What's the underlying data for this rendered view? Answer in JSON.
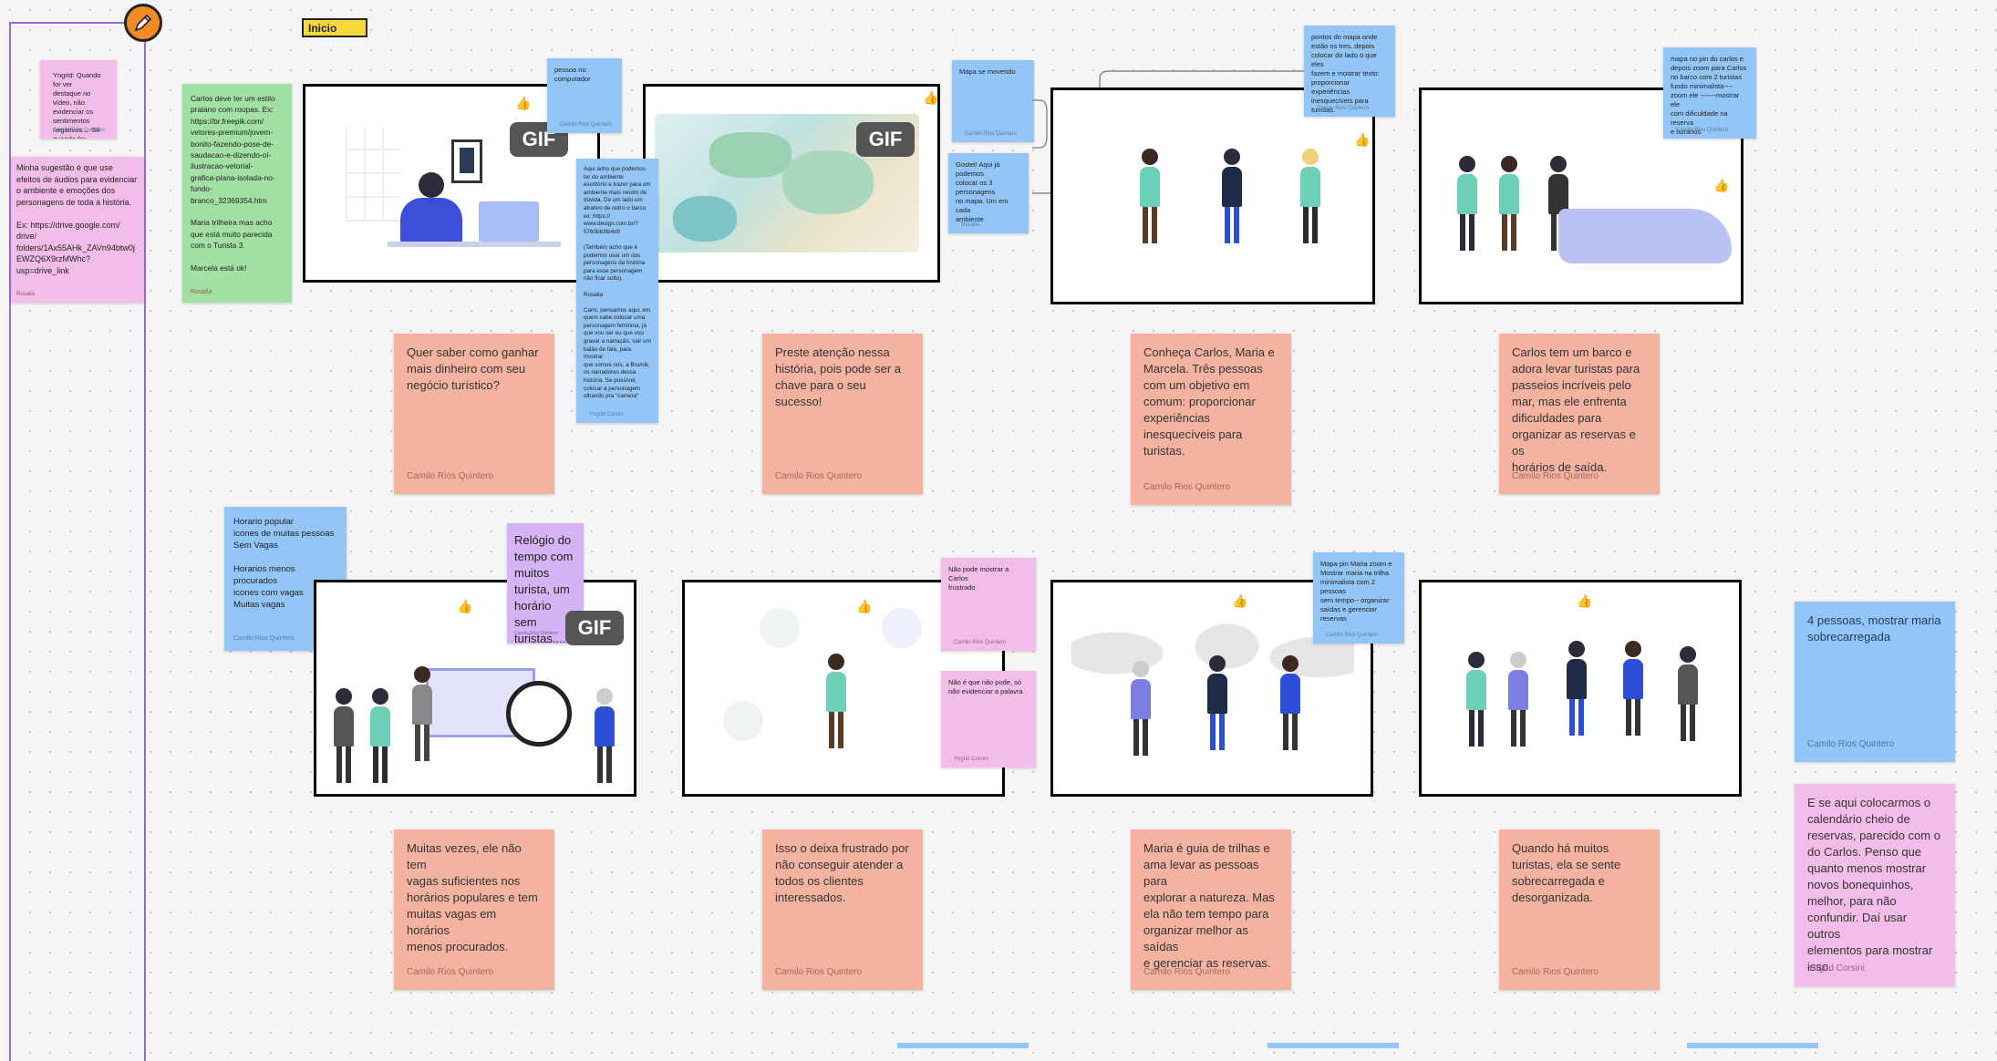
{
  "start_tag": "Inicio",
  "colors": {
    "salmon": "#f4b3a1",
    "blue": "#93c5f7",
    "pink": "#f3bde9",
    "green": "#a3e0a3",
    "lilac": "#d6b4f3",
    "section_border": "#9b6bd8"
  },
  "comments": {
    "c1_text": "Yngrid: Quando for ver\ndestaque no vídeo, não\nevidenciar os sentimentos\nnegativos.... Só quando for\nos positivos",
    "c1_author": "Camilo Rios Quintero",
    "c2_text": "Minha sugestão é que use\nefeitos de áudios para evidenciar\no ambiente e emoções dos\npersonagens de toda a história.\n\nEx: https://drive.google.com/\ndrive/\nfolders/1Ax55AHk_ZAVn94btw0j\nEWZQ6X9rzMWhc?\nusp=drive_link",
    "c2_author": "Rosalia",
    "c3_text": "Carlos deve ter um estilo\npraiano com roupas. Ex:\nhttps://br.freepik.com/\nvetores-premium/jovem-\nbonito-fazendo-pose-de-\nsaudacao-e-dizendo-oi-\nilustracao-vetorial-\ngrafica-plana-isolada-no-\nfundo-\nbranco_32369354.htm\n\nMaria trilheira mas acho\nque está muito parecida\ncom o Turista 3.\n\nMarcela está ok!",
    "c3_author": "Rosalia",
    "c4_text": "pessoa no computador",
    "c4_author": "Camilo Rios Quintero",
    "c5_text": "Aqui acho que podemos\nter do ambiente\nescritório e trazer para um\nambiente mais neutro de\ndúvida. De um lado um\natrativo de outro o barco\nex: https://\nwww.design.com.br/?\n5760bb3tb4d0\n\n(Também acho que é\npodemos usar um dos\npersonagens da história\npara esse personagem\nnão ficar solto).\n\nRosalia\n\nCami, pensamos aqui, em\nquem sabe colocar uma\npersonagem feminina, já\nque vou ser eu que vou\ngravar a narração, sair um\nbalão de fala, para mostrar\nque somos nós, a Brumik,\nos narradores dessa\nhistória. Se possível,\ncolocar a personagem\nolhando pra \"camera\"",
    "c5_author": "Yngrid Corsini",
    "c6_text": "Mapa se movendo",
    "c6_author": "Camilo Rios Quintero",
    "c7_text": "Gostei! Aqui já podemos\ncolocar os 3 personagens\nno mapa. Um em cada\nambiente.",
    "c7_author": "Rosalia",
    "c8_text": "pontos do mapa onde\nestão os tres, depois\ncolocar do lado o que eles\nfazem e mostrar texto:\nproporcionar experiências\ninesquecíveis para\nturistas.",
    "c8_author": "Camilo Rios Quintero",
    "c9_text": "mapa no pin do carlos e\ndepois zoom para Carlos\nno barco com 2 turistas\nfundo minimalista----\nzoom ele -------mostrar ele\ncom dificuldade na reserva\ne horarios",
    "c9_author": "Camilo Rios Quintero",
    "c10_text": "Horario popular\nicones de muitas pessoas\nSem Vagas\n\nHorarios menos\nprocurados\nicones com vagas\nMuitas vagas",
    "c10_author": "Camilo Rios Quintero",
    "c11_text": "Relógio do\ntempo com\nmuitos\nturista, um\nhorário sem\nturistas....",
    "c11_author": "Camilo Rios Quintero",
    "c12_text": "Não pode mostrar a Carlos\nfrustrado",
    "c12_author": "Camilo Rios Quintero",
    "c13_text": "Não é que não pode, só\nnão evidenciar a palavra",
    "c13_author": "Yngrid Corsini",
    "c14_text": "Mapa pin Maria zoom e\nMostrar maria na trilha\nminimalista com 2\npessoas\nsem tempo-- organizar\nsaídas e gerenciar\nreservas",
    "c14_author": "Camilo Rios Quintero",
    "c15_text": "4 pessoas, mostrar maria\nsobrecarregada",
    "c15_author": "Camilo Rios Quintero",
    "c16_text": "E se aqui colocarmos o\ncalendário cheio de\nreservas, parecido com o\ndo Carlos. Penso que\nquanto menos mostrar\nnovos bonequinhos,\nmelhor, para não\nconfundir. Daí usar outros\nelementos para mostrar\nisso.",
    "c16_author": "Yngrid Corsini"
  },
  "scenes": {
    "s1_text": "Quer saber como ganhar\nmais dinheiro com seu\nnegócio turístico?",
    "s2_text": "Preste atenção nessa\nhistória, pois pode ser a\nchave para o seu sucesso!",
    "s3_text": "Conheça Carlos, Maria e\nMarcela. Três pessoas\ncom um objetivo em\ncomum: proporcionar\nexperiências\ninesquecíveis para\nturistas.",
    "s4_text": "Carlos tem um barco e\nadora levar turistas para\npasseios incríveis pelo\nmar, mas ele enfrenta\ndificuldades para\norganizar as reservas e os\nhorários de saída.",
    "s5_text": "Muitas vezes, ele não tem\nvagas suficientes nos\nhorários populares e tem\nmuitas vagas em horários\nmenos procurados.",
    "s6_text": "Isso o deixa frustrado por\nnão conseguir atender a\ntodos os clientes\ninteressados.",
    "s7_text": "Maria é guia de trilhas e\nama levar as pessoas para\nexplorar a natureza. Mas\nela não tem tempo para\norganizar melhor as saídas\ne gerenciar as reservas.",
    "s8_text": "Quando há muitos\nturistas, ela se sente\nsobrecarregada e\ndesorganizada.",
    "author": "Camilo Rios Quintero"
  },
  "gif_label": "GIF"
}
